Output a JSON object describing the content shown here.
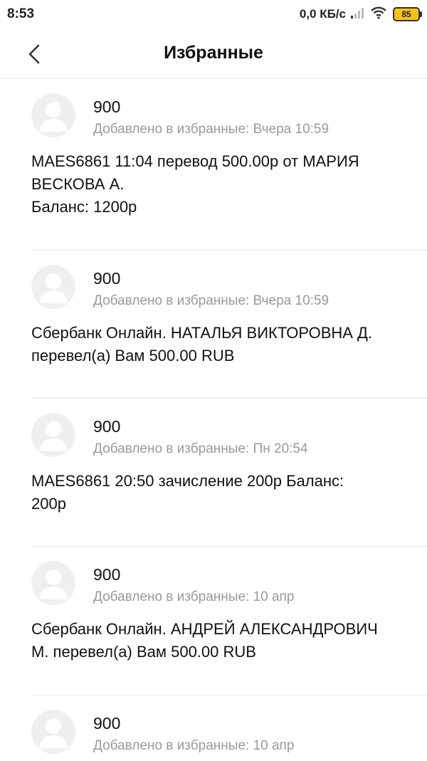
{
  "status_bar": {
    "time": "8:53",
    "net_speed": "0,0 КБ/с",
    "battery": "85",
    "icons": [
      "signal-icon",
      "wifi-icon",
      "battery-icon"
    ]
  },
  "header": {
    "title": "Избранные",
    "back_icon": "chevron-left-icon"
  },
  "messages": [
    {
      "sender": "900",
      "added": "Добавлено в избранные: Вчера 10:59",
      "text": "MAES6861 11:04 перевод 500.00р от МАРИЯ\nВЕСКОВА А.\nБаланс: 1200р"
    },
    {
      "sender": "900",
      "added": "Добавлено в избранные: Вчера 10:59",
      "text": "Сбербанк Онлайн. НАТАЛЬЯ ВИКТОРОВНА Д.\nперевел(а) Вам 500.00 RUB"
    },
    {
      "sender": "900",
      "added": "Добавлено в избранные: Пн 20:54",
      "text": "MAES6861 20:50 зачисление 200р Баланс:\n200р"
    },
    {
      "sender": "900",
      "added": "Добавлено в избранные: 10 апр",
      "text": "Сбербанк Онлайн. АНДРЕЙ АЛЕКСАНДРОВИЧ\nМ. перевел(а) Вам 500.00 RUB"
    },
    {
      "sender": "900",
      "added": "Добавлено в избранные: 10 апр",
      "text": ""
    }
  ]
}
